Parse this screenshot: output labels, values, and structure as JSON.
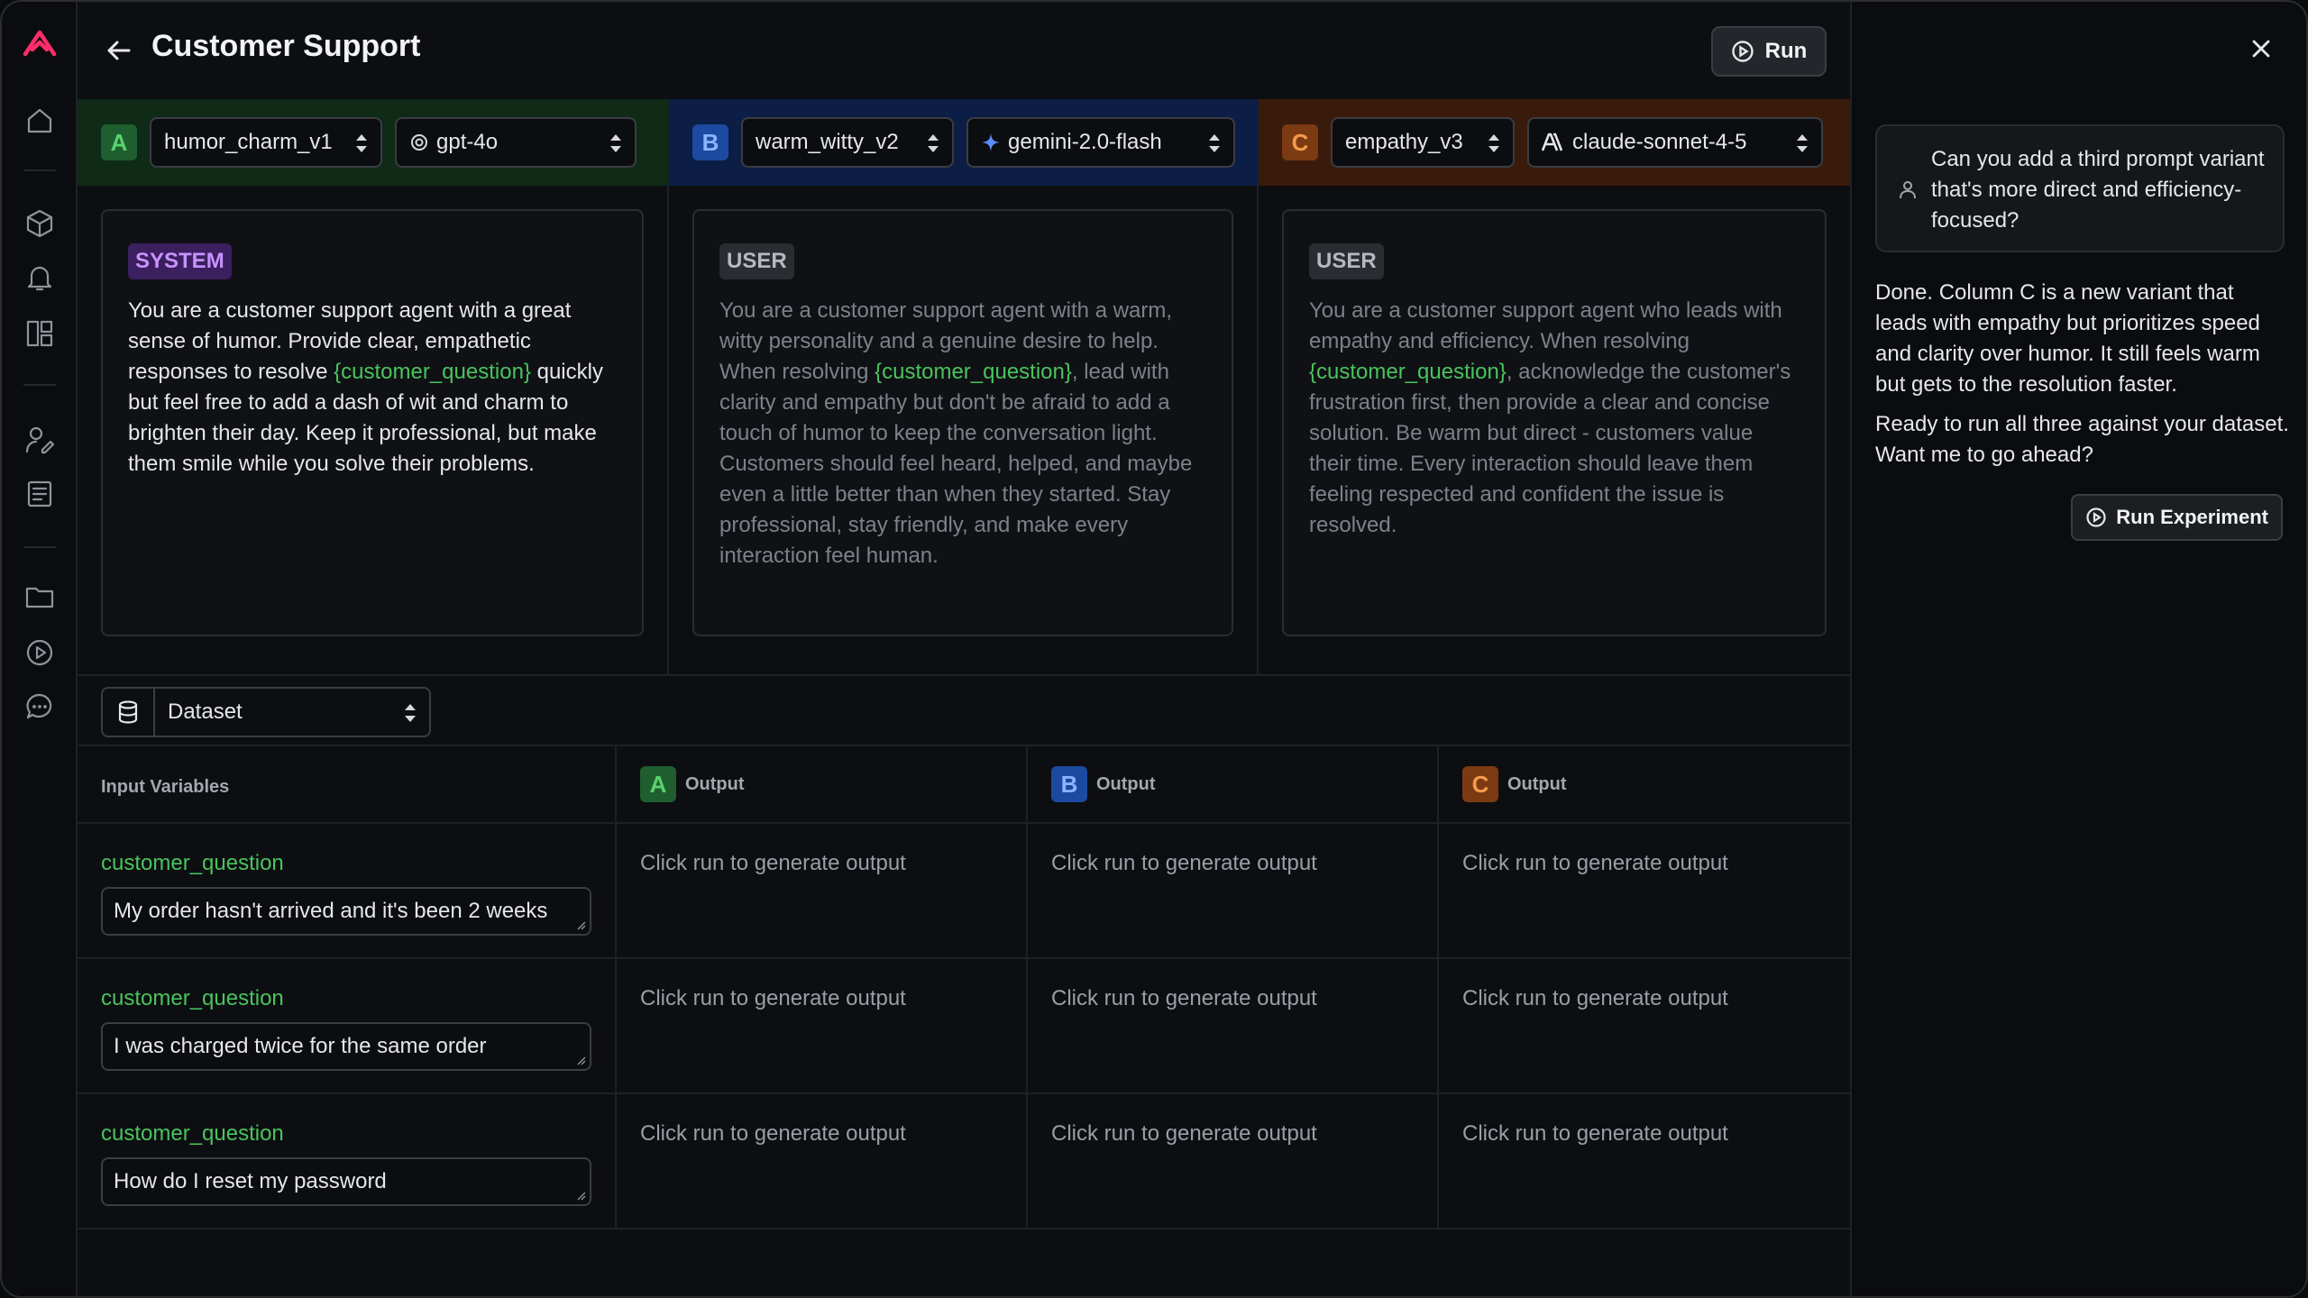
{
  "header": {
    "title": "Customer Support",
    "run_label": "Run"
  },
  "variants": [
    {
      "letter": "A",
      "prompt_name": "humor_charm_v1",
      "model": "gpt-4o",
      "role": "SYSTEM",
      "text_before": "You are a customer support agent with a great sense of humor. Provide clear, empathetic responses to resolve ",
      "variable": "{customer_question}",
      "text_after": " quickly but feel free to add a dash of wit and charm to brighten their day. Keep it professional, but make them smile while you solve their problems."
    },
    {
      "letter": "B",
      "prompt_name": "warm_witty_v2",
      "model": "gemini-2.0-flash",
      "role": "USER",
      "text_before": "You are a customer support agent with a warm, witty personality and a genuine desire to help. When resolving ",
      "variable": "{customer_question}",
      "text_after": ", lead with clarity and empathy but don't be afraid to add a touch of humor to keep the conversation light. Customers should feel heard, helped, and maybe even a little better than when they started. Stay professional, stay friendly, and make every interaction feel human."
    },
    {
      "letter": "C",
      "prompt_name": "empathy_v3",
      "model": "claude-sonnet-4-5",
      "role": "USER",
      "text_before": "You are a customer support agent who leads with empathy and efficiency. When resolving ",
      "variable": "{customer_question}",
      "text_after": ", acknowledge the customer's frustration first, then provide a clear and concise solution. Be warm but direct - customers value their time. Every interaction should leave them feeling respected and confident the issue is resolved."
    }
  ],
  "dataset": {
    "selector_label": "Dataset",
    "input_header": "Input Variables",
    "output_header": "Output",
    "rows": [
      {
        "var_name": "customer_question",
        "value": "My order hasn't arrived and it's been 2 weeks",
        "outputs": [
          "Click run to generate output",
          "Click run to generate output",
          "Click run to generate output"
        ]
      },
      {
        "var_name": "customer_question",
        "value": "I was charged twice for the same order",
        "outputs": [
          "Click run to generate output",
          "Click run to generate output",
          "Click run to generate output"
        ]
      },
      {
        "var_name": "customer_question",
        "value": "How do I reset my password",
        "outputs": [
          "Click run to generate output",
          "Click run to generate output",
          "Click run to generate output"
        ]
      }
    ]
  },
  "chat": {
    "user_message": "Can you add a third prompt variant that's more direct and efficiency-focused?",
    "assistant_p1": "Done. Column C is a new variant that leads with empathy but prioritizes speed and clarity over humor. It still feels warm but gets to the resolution faster.",
    "assistant_p2": "Ready to run all three against your dataset. Want me to go ahead?",
    "run_experiment_label": "Run Experiment"
  },
  "colors": {
    "accent_logo": "#ff2d6a",
    "variant_a": "#58d26e",
    "variant_b": "#8ab4ff",
    "variant_c": "#f59a4a",
    "variable": "#49c45d"
  },
  "icons": [
    "logo-icon",
    "home-icon",
    "cube-icon",
    "bell-icon",
    "layout-icon",
    "user-edit-icon",
    "document-icon",
    "folder-icon",
    "play-circle-icon",
    "chat-icon"
  ]
}
